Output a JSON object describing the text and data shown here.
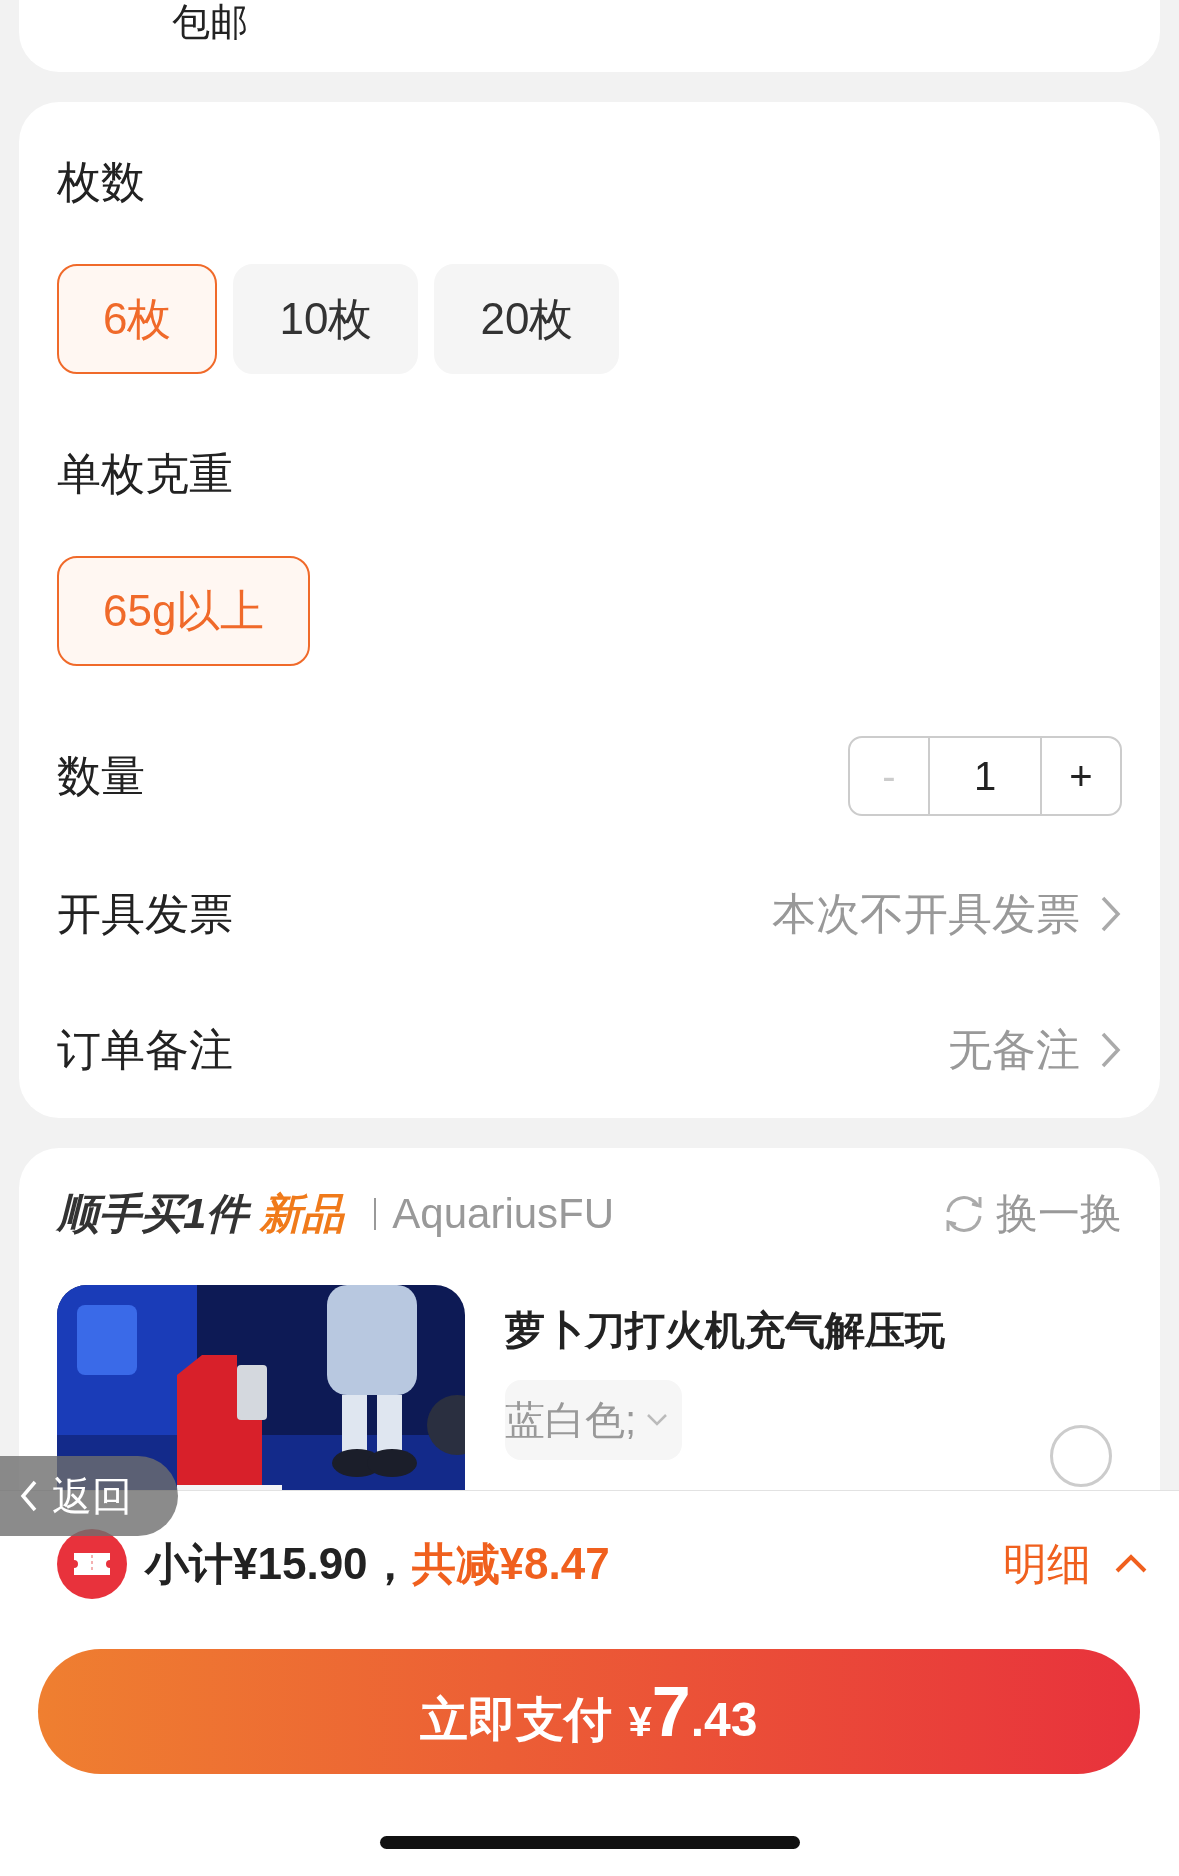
{
  "top_card": {
    "text": "包邮"
  },
  "options_card": {
    "groups": [
      {
        "title": "枚数",
        "options": [
          {
            "label": "6枚",
            "selected": true
          },
          {
            "label": "10枚",
            "selected": false
          },
          {
            "label": "20枚",
            "selected": false
          }
        ]
      },
      {
        "title": "单枚克重",
        "options": [
          {
            "label": "65g以上",
            "selected": true
          }
        ]
      }
    ],
    "quantity": {
      "label": "数量",
      "minus": "-",
      "value": "1",
      "plus": "+",
      "minus_disabled": true
    },
    "rows": [
      {
        "label": "开具发票",
        "value": "本次不开具发票"
      },
      {
        "label": "订单备注",
        "value": "无备注"
      }
    ]
  },
  "addon": {
    "title": "顺手买1件",
    "title_highlight": "新品",
    "shop": "AquariusFU",
    "refresh": "换一换",
    "product": {
      "title": "萝卜刀打火机充气解压玩",
      "spec": "蓝白色;",
      "selected": false
    }
  },
  "back": "返回",
  "summary": {
    "subtotal": "小计¥15.90，",
    "discount": "共减¥8.47",
    "detail": "明细",
    "expanded": false
  },
  "pay": {
    "label": "立即支付",
    "currency": "¥",
    "integer": "7",
    "decimal": ".43"
  }
}
